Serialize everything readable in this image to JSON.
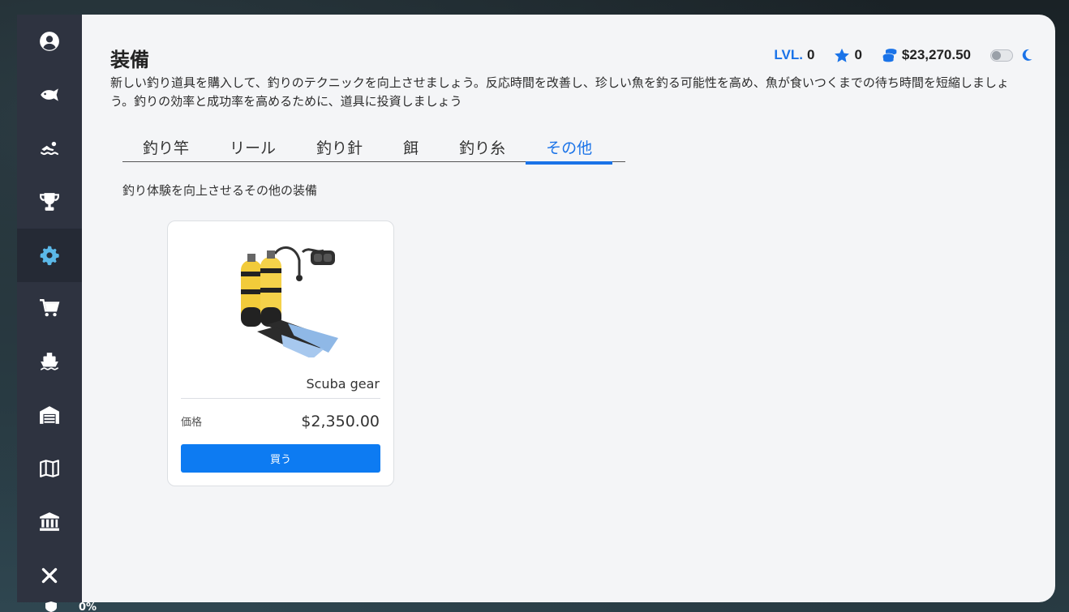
{
  "sidebar": {
    "items": [
      {
        "icon": "user-circle-icon",
        "active": false
      },
      {
        "icon": "fish-icon",
        "active": false
      },
      {
        "icon": "swimmer-icon",
        "active": false
      },
      {
        "icon": "trophy-icon",
        "active": false
      },
      {
        "icon": "gear-icon",
        "active": true
      },
      {
        "icon": "cart-icon",
        "active": false
      },
      {
        "icon": "ship-icon",
        "active": false
      },
      {
        "icon": "warehouse-icon",
        "active": false
      },
      {
        "icon": "map-icon",
        "active": false
      },
      {
        "icon": "bank-icon",
        "active": false
      },
      {
        "icon": "close-icon",
        "active": false
      }
    ]
  },
  "header": {
    "title": "装備",
    "level_label": "LVL.",
    "level_value": "0",
    "stars": "0",
    "money": "$23,270.50"
  },
  "description": "新しい釣り道具を購入して、釣りのテクニックを向上させましょう。反応時間を改善し、珍しい魚を釣る可能性を高め、魚が食いつくまでの待ち時間を短縮しましょう。釣りの効率と成功率を高めるために、道具に投資しましょう",
  "tabs": [
    {
      "label": "釣り竿",
      "active": false
    },
    {
      "label": "リール",
      "active": false
    },
    {
      "label": "釣り針",
      "active": false
    },
    {
      "label": "餌",
      "active": false
    },
    {
      "label": "釣り糸",
      "active": false
    },
    {
      "label": "その他",
      "active": true
    }
  ],
  "section_description": "釣り体験を向上させるその他の装備",
  "items": [
    {
      "name": "Scuba gear",
      "price_label": "価格",
      "price": "$2,350.00",
      "buy_label": "買う"
    }
  ],
  "bottom_hud": {
    "value": "0%"
  },
  "colors": {
    "accent": "#1a73e8",
    "button": "#0d7bf2",
    "sidebar_bg": "#2e3340",
    "sidebar_active": "#252a35",
    "sidebar_icon": "#ffffff",
    "sidebar_icon_active": "#5bb8e8"
  }
}
